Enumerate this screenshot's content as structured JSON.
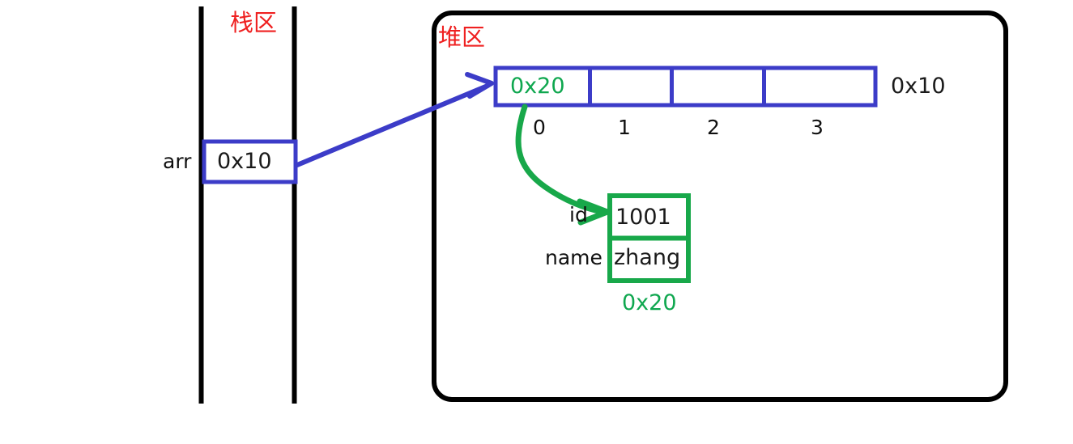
{
  "diagram": {
    "title_stack": "栈区",
    "title_heap": "堆区",
    "colors": {
      "blue": "#3c3cc8",
      "green": "#18a84a",
      "red": "#ef2020",
      "black": "#000000",
      "text": "#101010"
    }
  },
  "stack": {
    "region_label": "栈区",
    "variable": {
      "name": "arr",
      "value": "0x10"
    }
  },
  "heap": {
    "region_label": "堆区",
    "array": {
      "address_label": "0x10",
      "cells": [
        {
          "index": "0",
          "value": "0x20"
        },
        {
          "index": "1",
          "value": ""
        },
        {
          "index": "2",
          "value": ""
        },
        {
          "index": "3",
          "value": ""
        }
      ]
    },
    "object": {
      "address_label": "0x20",
      "fields": [
        {
          "name": "id",
          "value": "1001"
        },
        {
          "name": "name",
          "value": "zhang"
        }
      ]
    }
  },
  "arrows": [
    {
      "name": "arr-to-array",
      "from": "stack.arr",
      "to": "heap.array",
      "color": "#3c3cc8"
    },
    {
      "name": "array0-to-object",
      "from": "heap.array.cell0",
      "to": "heap.object",
      "color": "#18a84a"
    }
  ]
}
